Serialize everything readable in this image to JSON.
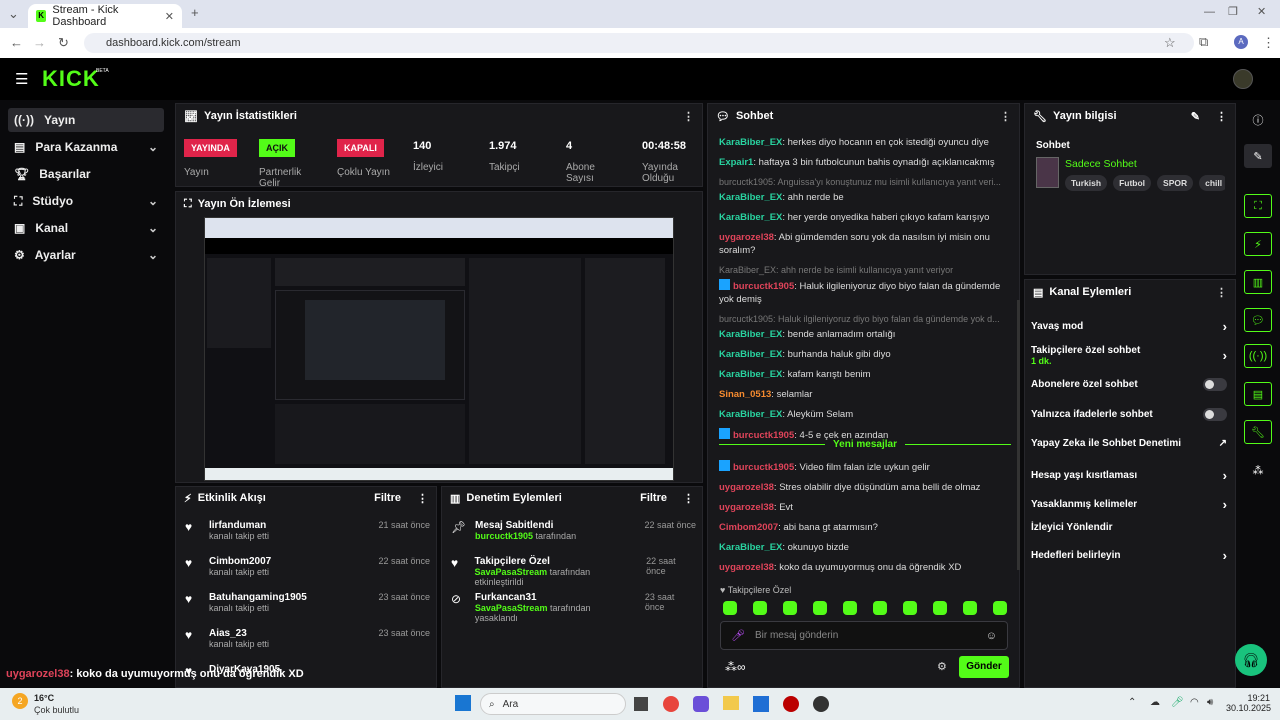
{
  "browser": {
    "tab_title": "Stream - Kick Dashboard",
    "url": "dashboard.kick.com/stream",
    "profile": "A"
  },
  "kick": {
    "logo": "KICK",
    "beta": "BETA"
  },
  "sidebar": {
    "items": [
      {
        "label": "Yayın",
        "icon": "broadcast-icon"
      },
      {
        "label": "Para Kazanma",
        "icon": "money-icon"
      },
      {
        "label": "Başarılar",
        "icon": "trophy-icon"
      },
      {
        "label": "Stüdyo",
        "icon": "studio-icon"
      },
      {
        "label": "Kanal",
        "icon": "channel-icon"
      },
      {
        "label": "Ayarlar",
        "icon": "gear-icon"
      }
    ]
  },
  "stats": {
    "title": "Yayın İstatistikleri",
    "items": [
      {
        "badge": "YAYINDA",
        "label": "Yayın"
      },
      {
        "badge": "AÇIK",
        "label": "Partnerlik Gelir"
      },
      {
        "badge": "KAPALI",
        "label": "Çoklu Yayın"
      },
      {
        "value": "140",
        "label": "İzleyici"
      },
      {
        "value": "1.974",
        "label": "Takipçi"
      },
      {
        "value": "4",
        "label": "Abone Sayısı"
      },
      {
        "value": "00:48:58",
        "label": "Yayında Olduğu"
      }
    ]
  },
  "preview": {
    "title": "Yayın Ön İzlemesi"
  },
  "activity": {
    "title": "Etkinlik Akışı",
    "filter": "Filtre",
    "items": [
      {
        "name": "lirfanduman",
        "sub": "kanalı takip etti",
        "time": "21 saat önce"
      },
      {
        "name": "Cimbom2007",
        "sub": "kanalı takip etti",
        "time": "22 saat önce"
      },
      {
        "name": "Batuhangaming1905",
        "sub": "kanalı takip etti",
        "time": "23 saat önce"
      },
      {
        "name": "Aias_23",
        "sub": "kanalı takip etti",
        "time": "23 saat önce"
      },
      {
        "name": "DiyarKaya1905",
        "sub": "",
        "time": ""
      }
    ]
  },
  "moderation": {
    "title": "Denetim Eylemleri",
    "filter": "Filtre",
    "items": [
      {
        "name": "Mesaj Sabitlendi",
        "by": "burcuctk1905",
        "sub": "tarafından",
        "time": "22 saat önce"
      },
      {
        "name": "Takipçilere Özel",
        "by": "SavaPasaStream",
        "sub": "tarafından etkinleştirildi",
        "time": "22 saat önce"
      },
      {
        "name": "Furkancan31",
        "by": "SavaPasaStream",
        "sub": "tarafından yasaklandı",
        "time": "23 saat önce"
      }
    ]
  },
  "chat": {
    "title": "Sohbet",
    "new_messages": "Yeni mesajlar",
    "followers_only": "Takipçilere Özel",
    "input_placeholder": "Bir mesaj gönderin",
    "send": "Gönder",
    "messages": [
      {
        "user": "KaraBiber_EX",
        "color": "c",
        "text": ": herkes diyo hocanın en çok istediği oyuncu diye"
      },
      {
        "user": "Expair1",
        "color": "c",
        "text": ": haftaya 3 bin futbolcunun bahis oynadığı açıklanıcakmış"
      },
      {
        "reply": "burcuctk1905: Anguissa'yı konuştunuz mu isimli kullanıcıya yanıt veri..."
      },
      {
        "user": "KaraBiber_EX",
        "color": "c",
        "text": ": ahh nerde be"
      },
      {
        "user": "KaraBiber_EX",
        "color": "c",
        "text": ": her yerde onyedika haberi çıkıyo kafam karışıyo"
      },
      {
        "user": "uygarozel38",
        "color": "r",
        "text": ": Abi gümdemden soru yok da nasılsın iyi misin onu soralım?"
      },
      {
        "reply": "KaraBiber_EX: ahh nerde be isimli kullanıcıya yanıt veriyor"
      },
      {
        "user": "burcuctk1905",
        "color": "r",
        "text": ": Haluk ilgileniyoruz diyo biyo falan da gündemde yok demiş"
      },
      {
        "reply": "burcuctk1905: Haluk ilgileniyoruz diyo biyo falan da gündemde yok d..."
      },
      {
        "user": "KaraBiber_EX",
        "color": "c",
        "text": ": bende anlamadım ortalığı"
      },
      {
        "user": "KaraBiber_EX",
        "color": "c",
        "text": ": burhanda haluk gibi diyo"
      },
      {
        "user": "KaraBiber_EX",
        "color": "c",
        "text": ": kafam karıştı benim"
      },
      {
        "user": "Sinan_0513",
        "color": "o",
        "text": ": selamlar"
      },
      {
        "user": "KaraBiber_EX",
        "color": "c",
        "text": ": Aleyküm Selam"
      },
      {
        "user": "burcuctk1905",
        "color": "r",
        "text": ": 4-5 e çek en azından"
      }
    ],
    "new": [
      {
        "user": "burcuctk1905",
        "color": "r",
        "text": ": Video film falan izle uykun gelir"
      },
      {
        "user": "uygarozel38",
        "color": "r",
        "text": ": Stres olabilir diye düşündüm ama belli de olmaz"
      },
      {
        "user": "uygarozel38",
        "color": "r",
        "text": ": Evt"
      },
      {
        "user": "Cimbom2007",
        "color": "r",
        "text": ": abi bana gt atarmısın?"
      },
      {
        "user": "KaraBiber_EX",
        "color": "c",
        "text": ": okunuyo bizde"
      },
      {
        "user": "uygarozel38",
        "color": "r",
        "text": ": koko da uyumuyormuş onu da öğrendik XD"
      }
    ]
  },
  "info": {
    "title": "Yayın bilgisi",
    "heading": "Sohbet",
    "stream_title": "Sadece Sohbet",
    "tags": [
      "Turkish",
      "Futbol",
      "SPOR",
      "chill"
    ]
  },
  "channel": {
    "title": "Kanal Eylemleri",
    "items": [
      {
        "label": "Yavaş mod",
        "type": "chev"
      },
      {
        "label": "Takipçilere özel sohbet",
        "sub": "1 dk.",
        "type": "chev"
      },
      {
        "label": "Abonelere özel sohbet",
        "type": "toggle"
      },
      {
        "label": "Yalnızca ifadelerle sohbet",
        "type": "toggle"
      },
      {
        "label": "Yapay Zeka ile Sohbet Denetimi",
        "type": "ext"
      },
      {
        "label": "Hesap yaşı kısıtlaması",
        "type": "chev"
      },
      {
        "label": "Yasaklanmış kelimeler",
        "type": "chev"
      },
      {
        "label": "İzleyici Yönlendir",
        "type": "none"
      },
      {
        "label": "Hedefleri belirleyin",
        "type": "chev"
      }
    ]
  },
  "overlay": {
    "user": "uygarozel38",
    "text": ": koko da uyumuyormuş onu da öğrendik XD"
  },
  "taskbar": {
    "temp": "16°C",
    "weather": "Çok bulutlu",
    "search": "Ara",
    "time": "19:21",
    "date": "30.10.2025",
    "notif": "2"
  }
}
